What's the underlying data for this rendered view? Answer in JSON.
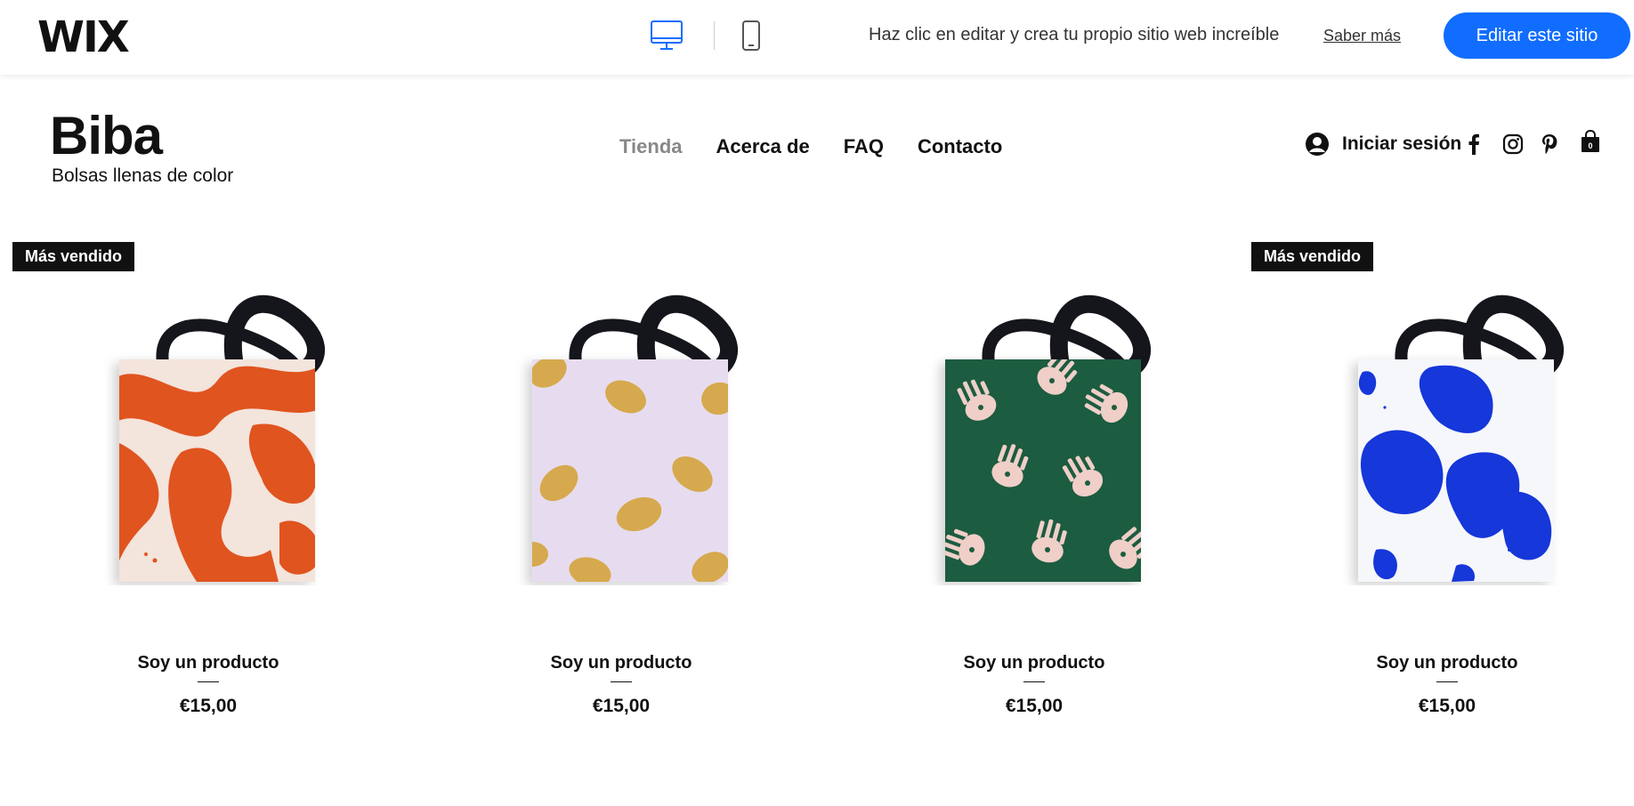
{
  "wix_banner": {
    "logo": "WIX",
    "message": "Haz clic en editar y crea tu propio sitio web increíble",
    "learn_more": "Saber más",
    "edit_button": "Editar este sitio",
    "accent": "#116dff"
  },
  "site": {
    "brand": "Biba",
    "tagline": "Bolsas llenas de color",
    "nav": [
      {
        "label": "Tienda",
        "active": true
      },
      {
        "label": "Acerca de",
        "active": false
      },
      {
        "label": "FAQ",
        "active": false
      },
      {
        "label": "Contacto",
        "active": false
      }
    ],
    "login_label": "Iniciar sesión",
    "cart_count": "0",
    "social_icons": [
      "facebook-icon",
      "instagram-icon",
      "pinterest-icon"
    ]
  },
  "products": [
    {
      "badge": "Más vendido",
      "name": "Soy un producto",
      "price": "€15,00",
      "pattern": "orange-brush",
      "bg": "#f3e4dc",
      "fg": "#e0541f"
    },
    {
      "badge": "",
      "name": "Soy un producto",
      "price": "€15,00",
      "pattern": "lemons",
      "bg": "#e7dcef",
      "fg": "#d6a94e"
    },
    {
      "badge": "",
      "name": "Soy un producto",
      "price": "€15,00",
      "pattern": "hands",
      "bg": "#1e5c3f",
      "fg": "#efcfc8"
    },
    {
      "badge": "Más vendido",
      "name": "Soy un producto",
      "price": "€15,00",
      "pattern": "blue-blobs",
      "bg": "#f6f7fb",
      "fg": "#1637d9"
    }
  ]
}
